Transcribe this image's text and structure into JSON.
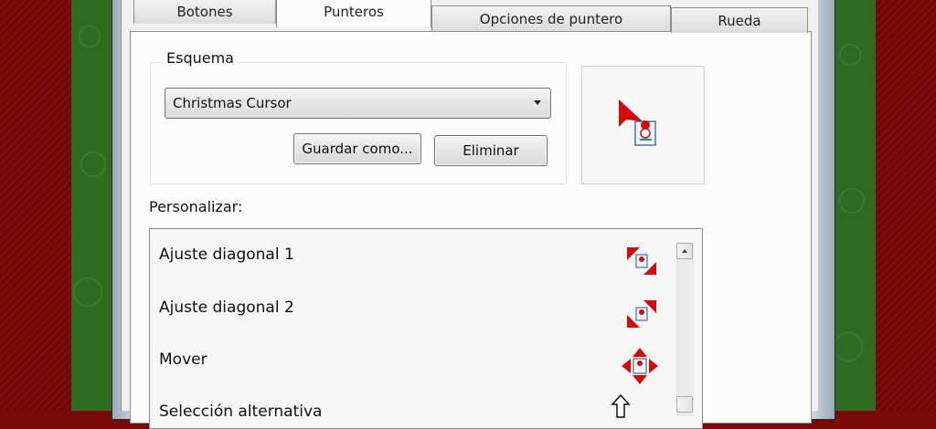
{
  "tabs": [
    {
      "label": "Botones"
    },
    {
      "label": "Punteros"
    },
    {
      "label": "Opciones de puntero"
    },
    {
      "label": "Rueda"
    }
  ],
  "active_tab": "Punteros",
  "scheme": {
    "legend": "Esquema",
    "selected": "Christmas Cursor",
    "save_label": "Guardar como...",
    "delete_label": "Eliminar"
  },
  "customize": {
    "label": "Personalizar:",
    "items": [
      {
        "label": "Ajuste diagonal 1",
        "icon": "diagonal-resize-1-icon"
      },
      {
        "label": "Ajuste diagonal 2",
        "icon": "diagonal-resize-2-icon"
      },
      {
        "label": "Mover",
        "icon": "move-icon"
      },
      {
        "label": "Selección alternativa",
        "icon": "alternate-select-icon"
      }
    ]
  },
  "colors": {
    "accent_red": "#d20a0a",
    "wallpaper_green": "#2f6a21",
    "wallpaper_red": "#7a0a0a"
  }
}
